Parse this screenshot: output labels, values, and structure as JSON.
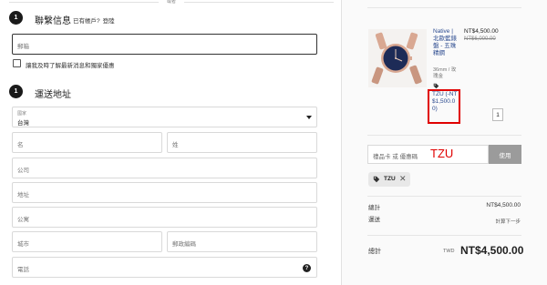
{
  "divider_text": "或者",
  "contact": {
    "step": "1",
    "title": "聯繫信息",
    "have_account": "已有帳戶?",
    "login": "登陸",
    "email_placeholder": "郵箱",
    "newsletter_label": "讓我及時了解最新消息和獨家優惠"
  },
  "shipping": {
    "step": "1",
    "title": "運送地址",
    "country_label": "國家",
    "country_value": "台灣",
    "first_name": "名",
    "last_name": "姓",
    "company": "公司",
    "address": "地址",
    "apartment": "公寓",
    "city": "城市",
    "postal": "郵政編碼",
    "phone": "電話",
    "help_icon": "?"
  },
  "summary": {
    "product_name": "Native | 北歐藍錶盤 - 五珠精鋼",
    "product_variant": "36mm / 玫瑰金",
    "discount_text": "TZU (-NT$1,500.00)",
    "price_now": "NT$4,500.00",
    "price_old": "NT$6,000.00",
    "quantity": "1",
    "gift_placeholder": "禮品卡 或 優惠碼",
    "gift_annotation": "TZU",
    "apply_label": "使用",
    "chip_code": "TZU",
    "chip_remove": "✕",
    "subtotal_label": "總計",
    "subtotal_value": "NT$4,500.00",
    "shipping_label": "運送",
    "shipping_value": "計算下一步",
    "total_label": "總計",
    "total_currency": "TWD",
    "total_value": "NT$4,500.00"
  },
  "colors": {
    "accent_red": "#e00000",
    "link_blue": "#2b4a8f",
    "step_black": "#1a1a1a",
    "apply_gray": "#9b9b9b"
  }
}
